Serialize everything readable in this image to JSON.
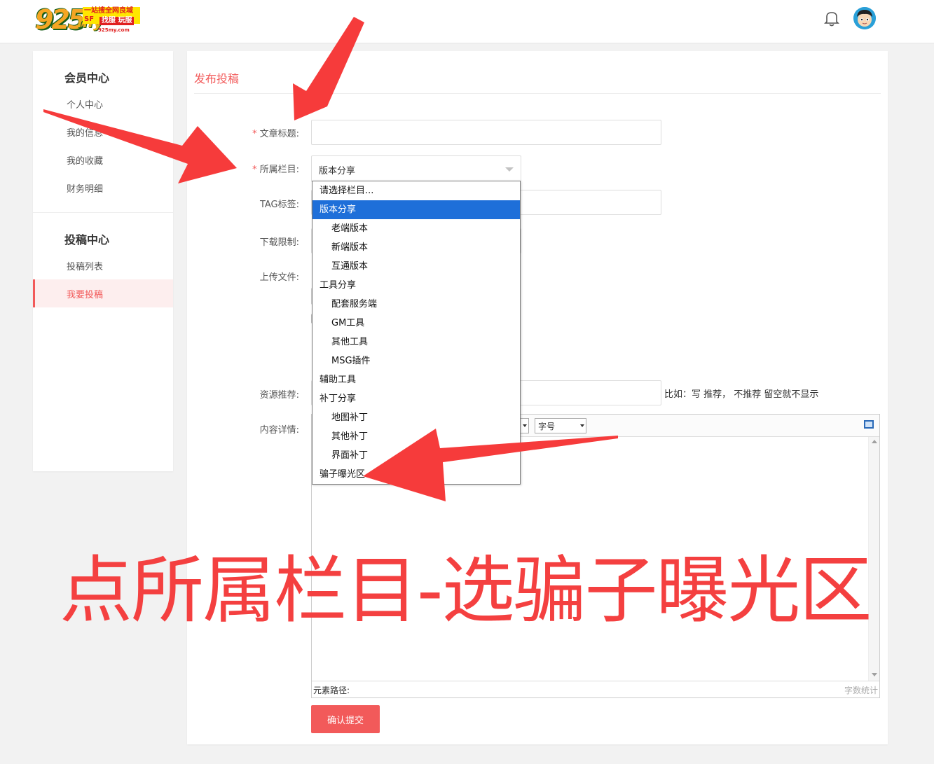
{
  "header": {
    "logo": {
      "number": "925",
      "suffix": "my",
      "slogan_line1": "一站搜全网良域SF",
      "slogan_line2": "找服 玩服",
      "url": "925my.com"
    }
  },
  "sidebar": {
    "section1_title": "会员中心",
    "section1_items": [
      "个人中心",
      "我的信息",
      "我的收藏",
      "财务明细"
    ],
    "section2_title": "投稿中心",
    "section2_items": [
      "投稿列表",
      "我要投稿"
    ]
  },
  "main": {
    "title": "发布投稿",
    "form": {
      "title_label": "文章标题:",
      "category_label": "所属栏目:",
      "category_value": "版本分享",
      "tag_label": "TAG标签:",
      "download_label": "下载限制:",
      "upload_label": "上传文件:",
      "recommend_label": "资源推荐:",
      "recommend_hint": "比如：写 推荐， 不推荐 留空就不显示",
      "content_label": "内容详情:",
      "required_mark": "*"
    },
    "editor": {
      "fontsize_select": "字号",
      "path_label": "元素路径:",
      "word_count_label": "字数统计"
    },
    "submit_label": "确认提交"
  },
  "dropdown": {
    "options": [
      {
        "label": "请选择栏目...",
        "level": 0
      },
      {
        "label": "版本分享",
        "level": 0,
        "selected": true
      },
      {
        "label": "老端版本",
        "level": 1
      },
      {
        "label": "新端版本",
        "level": 1
      },
      {
        "label": "互通版本",
        "level": 1
      },
      {
        "label": "工具分享",
        "level": 0
      },
      {
        "label": "配套服务端",
        "level": 1
      },
      {
        "label": "GM工具",
        "level": 1
      },
      {
        "label": "其他工具",
        "level": 1
      },
      {
        "label": "MSG插件",
        "level": 1
      },
      {
        "label": "辅助工具",
        "level": 0
      },
      {
        "label": "补丁分享",
        "level": 0
      },
      {
        "label": "地图补丁",
        "level": 1
      },
      {
        "label": "其他补丁",
        "level": 1
      },
      {
        "label": "界面补丁",
        "level": 1
      },
      {
        "label": "骗子曝光区",
        "level": 0
      }
    ]
  },
  "annotation": {
    "caption": "点所属栏目-选骗子曝光区"
  },
  "colors": {
    "accent": "#f25a5a",
    "selection": "#1e6fd9",
    "annotation_red": "#f44040"
  }
}
